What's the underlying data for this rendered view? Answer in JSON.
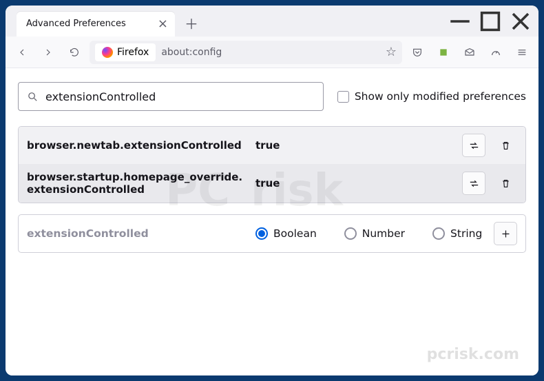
{
  "tab": {
    "title": "Advanced Preferences"
  },
  "url": {
    "identity_label": "Firefox",
    "path": "about:config"
  },
  "search": {
    "value": "extensionControlled",
    "checkbox_label": "Show only modified preferences"
  },
  "prefs": [
    {
      "name": "browser.newtab.extensionControlled",
      "value": "true"
    },
    {
      "name": "browser.startup.homepage_override.extensionControlled",
      "value": "true"
    }
  ],
  "newpref": {
    "name": "extensionControlled",
    "types": {
      "boolean": "Boolean",
      "number": "Number",
      "string": "String"
    },
    "selected": "boolean"
  },
  "watermark": {
    "brand_left": "PC",
    "brand_right": "risk",
    "domain": "pcrisk.com"
  }
}
